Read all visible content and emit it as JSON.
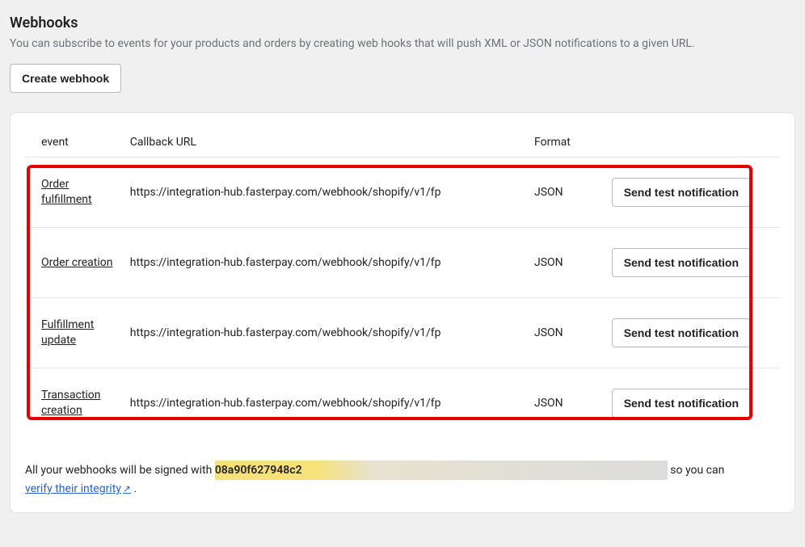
{
  "header": {
    "title": "Webhooks",
    "description": "You can subscribe to events for your products and orders by creating web hooks that will push XML or JSON notifications to a given URL.",
    "create_button_label": "Create webhook"
  },
  "table": {
    "columns": {
      "event": "event",
      "callback_url": "Callback URL",
      "format": "Format"
    },
    "send_test_label": "Send test notification",
    "rows": [
      {
        "event": "Order fulfillment",
        "url": "https://integration-hub.fasterpay.com/webhook/shopify/v1/fp",
        "format": "JSON"
      },
      {
        "event": "Order creation",
        "url": "https://integration-hub.fasterpay.com/webhook/shopify/v1/fp",
        "format": "JSON"
      },
      {
        "event": "Fulfillment update",
        "url": "https://integration-hub.fasterpay.com/webhook/shopify/v1/fp",
        "format": "JSON"
      },
      {
        "event": "Transaction creation",
        "url": "https://integration-hub.fasterpay.com/webhook/shopify/v1/fp",
        "format": "JSON"
      }
    ]
  },
  "footer": {
    "prefix": "All your webhooks will be signed with ",
    "signing_key_visible": "08a90f627948c2",
    "suffix": " so you can ",
    "verify_label": "verify their integrity",
    "period": " ."
  }
}
